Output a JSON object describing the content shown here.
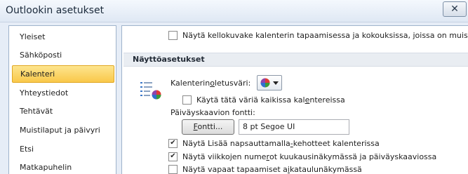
{
  "window": {
    "title": "Outlookin asetukset",
    "close_label": "✕"
  },
  "sidebar": {
    "items": [
      {
        "label": "Yleiset"
      },
      {
        "label": "Sähköposti"
      },
      {
        "label": "Kalenteri",
        "selected": true
      },
      {
        "label": "Yhteystiedot"
      },
      {
        "label": "Tehtävät"
      },
      {
        "label": "Muistilaput ja päivyri"
      },
      {
        "label": "Etsi"
      },
      {
        "label": "Matkapuhelin"
      }
    ]
  },
  "content": {
    "top_option": {
      "label": "Näytä kellokuvake kalenterin tapaamisessa ja kokouksissa, joissa on muistutus",
      "checked": false
    },
    "section_title": "Näyttöasetukset",
    "default_color": {
      "label_pre": "Kalenterin ",
      "label_u": "o",
      "label_post": "letusväri:"
    },
    "use_color_all": {
      "label_pre": "Käytä tätä väriä kaikissa kal",
      "label_u": "e",
      "label_post": "ntereissa",
      "checked": false
    },
    "date_nav_font_label": "Päiväyskaavion fontti:",
    "font_button": {
      "label_u": "F",
      "label_post": "ontti..."
    },
    "font_value": "8 pt Segoe UI",
    "show_click_to_add": {
      "label_pre": "Näytä Lisää napsauttamalla ",
      "label_u": "-",
      "label_post": "kehotteet kalenterissa",
      "checked": true
    },
    "show_week_numbers": {
      "label_pre": "Näytä viikkojen nume",
      "label_u": "r",
      "label_post": "ot kuukausinäkymässä ja päiväyskaaviossa",
      "checked": true
    },
    "show_free_appointments": {
      "label_pre": "Näytä vapaat tapaamiset a",
      "label_u": "i",
      "label_post": "kataulunäkymässä",
      "checked": false
    }
  },
  "colors": {
    "selected_item": "#f9c84a",
    "section_header_bg": "#e9edf2",
    "window_bg": "#e6edf7"
  },
  "icons": [
    "calendar-options-icon",
    "color-wheel-icon",
    "chevron-down-icon",
    "close-icon"
  ]
}
